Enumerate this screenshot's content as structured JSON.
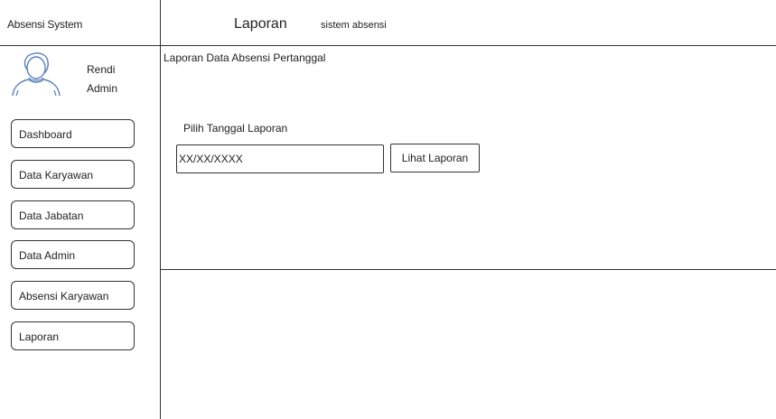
{
  "app": {
    "title": "Absensi System"
  },
  "header": {
    "title": "Laporan",
    "subtitle": "sistem absensi"
  },
  "user": {
    "name": "Rendi",
    "role": "Admin",
    "avatar_icon": "user-avatar-icon"
  },
  "sidebar": {
    "items": [
      {
        "label": "Dashboard"
      },
      {
        "label": "Data Karyawan"
      },
      {
        "label": "Data Jabatan"
      },
      {
        "label": "Data Admin"
      },
      {
        "label": "Absensi Karyawan"
      },
      {
        "label": "Laporan"
      }
    ]
  },
  "main": {
    "section_title": "Laporan Data Absensi Pertanggal",
    "date_label": "Pilih Tanggal Laporan",
    "date_value": "XX/XX/XXXX",
    "view_button_label": "Lihat Laporan"
  }
}
